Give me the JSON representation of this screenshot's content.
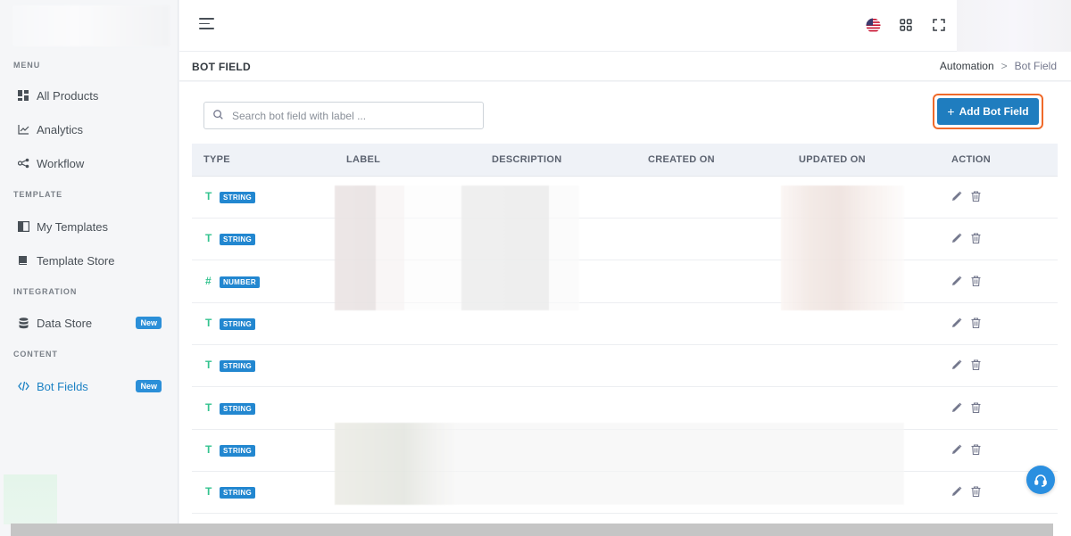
{
  "sidebar": {
    "sections": [
      {
        "title": "MENU"
      },
      {
        "title": "TEMPLATE"
      },
      {
        "title": "INTEGRATION"
      },
      {
        "title": "CONTENT"
      }
    ],
    "items": [
      {
        "label": "All Products",
        "icon": "grid-icon"
      },
      {
        "label": "Analytics",
        "icon": "chart-line-icon"
      },
      {
        "label": "Workflow",
        "icon": "share-nodes-icon"
      },
      {
        "label": "My Templates",
        "icon": "book-icon"
      },
      {
        "label": "Template Store",
        "icon": "book-closed-icon"
      },
      {
        "label": "Data Store",
        "icon": "database-icon",
        "badge": "New"
      },
      {
        "label": "Bot Fields",
        "icon": "code-icon",
        "badge": "New",
        "active": true
      }
    ]
  },
  "header": {
    "page_title": "BOT FIELD",
    "breadcrumb": {
      "parent": "Automation",
      "separator": ">",
      "current": "Bot Field"
    }
  },
  "toolbar": {
    "search_placeholder": "Search bot field with label ...",
    "add_button_label": "Add Bot Field",
    "add_button_plus": "+"
  },
  "table": {
    "columns": [
      "TYPE",
      "LABEL",
      "DESCRIPTION",
      "CREATED ON",
      "UPDATED ON",
      "ACTION"
    ],
    "rows": [
      {
        "type_icon": "T",
        "type": "STRING"
      },
      {
        "type_icon": "T",
        "type": "STRING"
      },
      {
        "type_icon": "#",
        "type": "NUMBER"
      },
      {
        "type_icon": "T",
        "type": "STRING"
      },
      {
        "type_icon": "T",
        "type": "STRING"
      },
      {
        "type_icon": "T",
        "type": "STRING"
      },
      {
        "type_icon": "T",
        "type": "STRING"
      },
      {
        "type_icon": "T",
        "type": "STRING"
      }
    ]
  },
  "colors": {
    "accent": "#1f7dbf",
    "badge": "#2287d0",
    "type_icon": "#34c38f",
    "active_nav": "#1d82c4",
    "focus_ring": "#f06a2a"
  }
}
